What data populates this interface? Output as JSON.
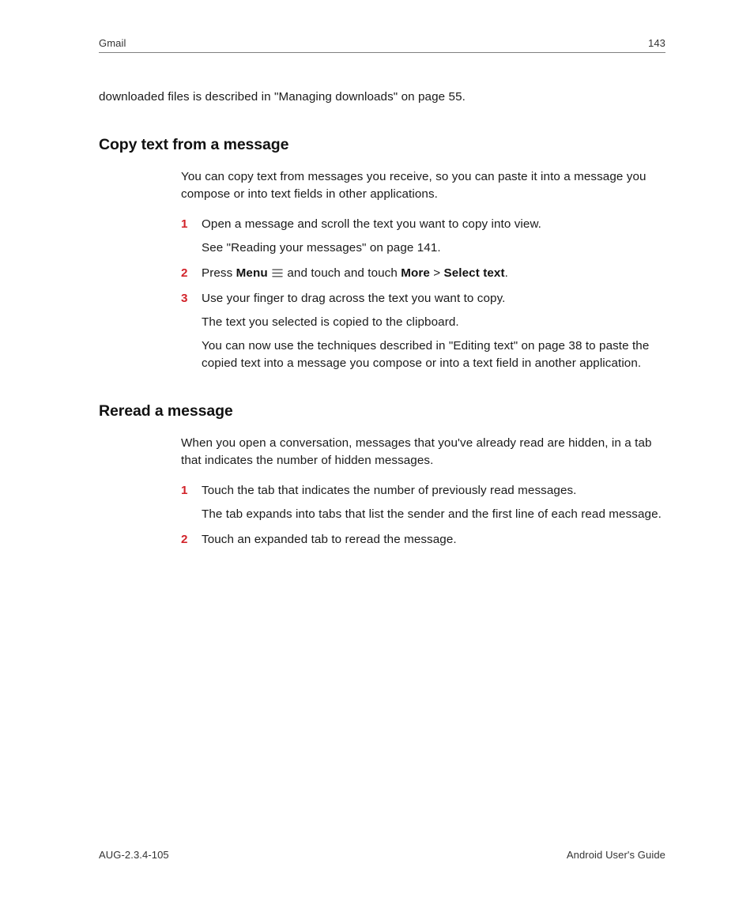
{
  "header": {
    "section": "Gmail",
    "page_number": "143"
  },
  "continuation_para": "downloaded files is described in \"Managing downloads\" on page 55.",
  "section1": {
    "title": "Copy text from a message",
    "intro": "You can copy text from messages you receive, so you can paste it into a message you compose or into text fields in other applications.",
    "steps": [
      {
        "marker": "1",
        "text": "Open a message and scroll the text you want to copy into view.",
        "sub": [
          "See \"Reading your messages\" on page 141."
        ]
      },
      {
        "marker": "2",
        "parts": {
          "p1": "Press ",
          "b1": "Menu",
          "p2": " and touch and touch ",
          "b2": "More",
          "sep": " > ",
          "b3": "Select text",
          "p3": "."
        }
      },
      {
        "marker": "3",
        "text": "Use your finger to drag across the text you want to copy.",
        "sub": [
          "The text you selected is copied to the clipboard.",
          "You can now use the techniques described in \"Editing text\" on page 38 to paste the copied text into a message you compose or into a text field in another application."
        ]
      }
    ]
  },
  "section2": {
    "title": "Reread a message",
    "intro": "When you open a conversation, messages that you've already read are hidden, in a tab that indicates the number of hidden messages.",
    "steps": [
      {
        "marker": "1",
        "text": "Touch the tab that indicates the number of previously read messages.",
        "sub": [
          "The tab expands into tabs that list the sender and the first line of each read message."
        ]
      },
      {
        "marker": "2",
        "text": "Touch an expanded tab to reread the message."
      }
    ]
  },
  "footer": {
    "doc_id": "AUG-2.3.4-105",
    "doc_title": "Android User's Guide"
  }
}
